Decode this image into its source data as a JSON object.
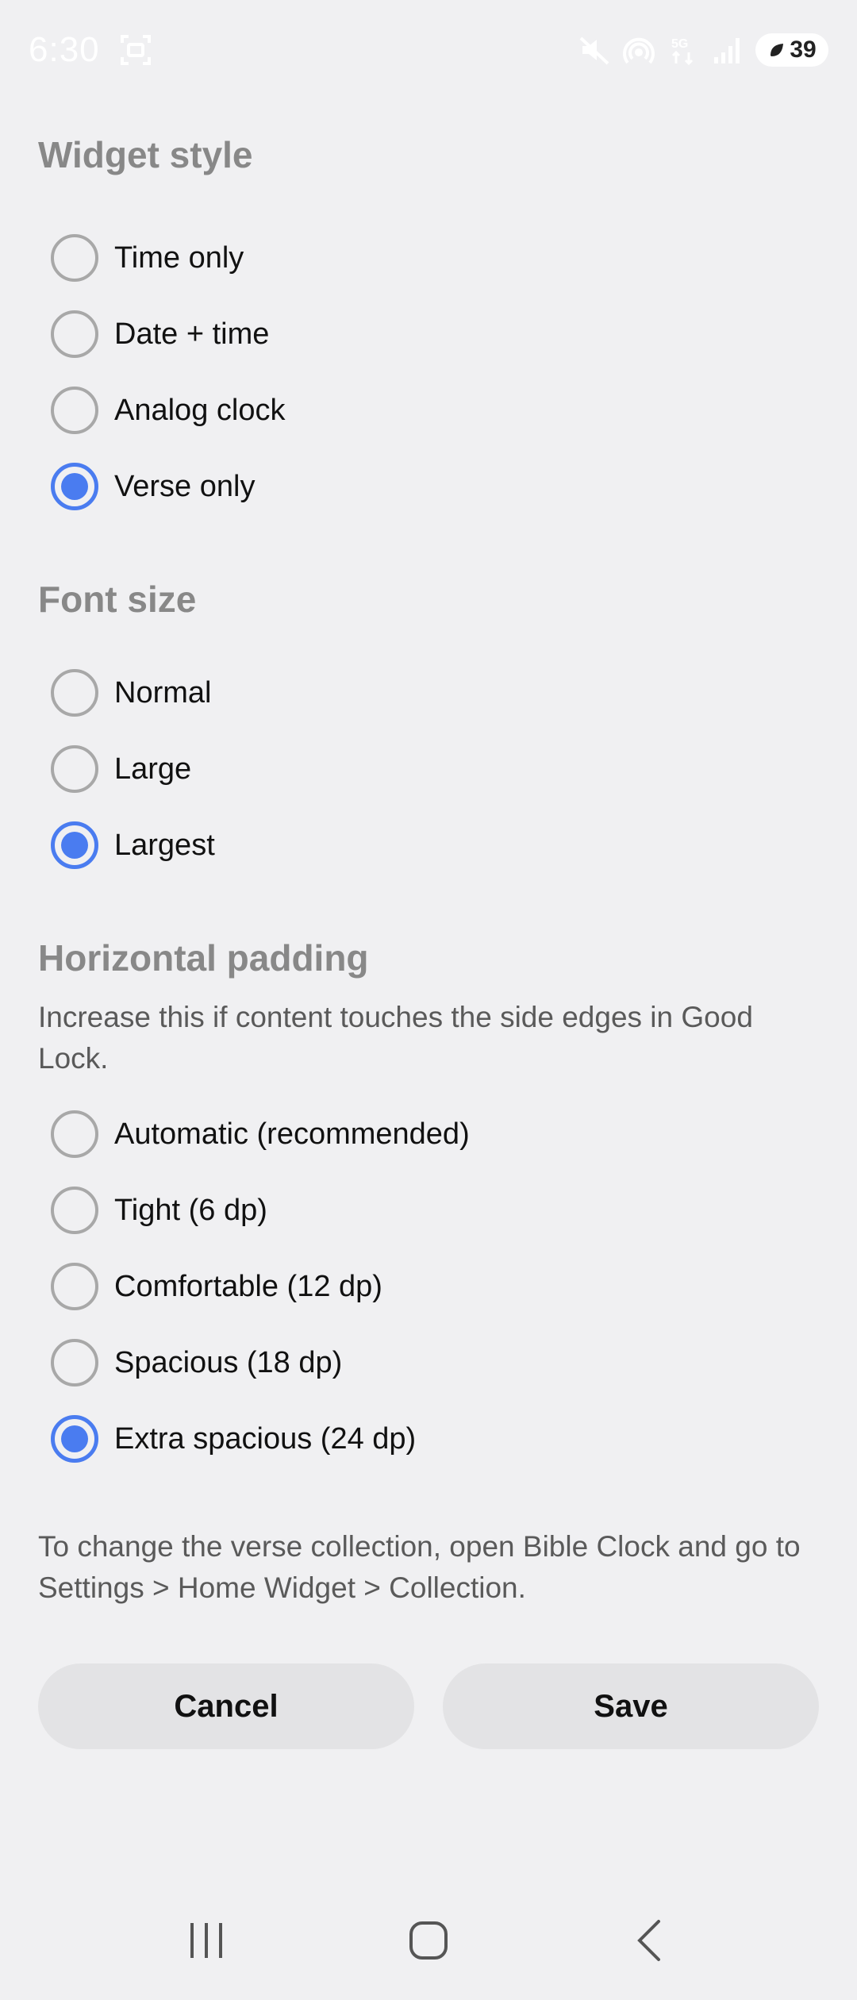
{
  "status_bar": {
    "time": "6:30",
    "battery": "39",
    "icons": [
      "screenshot-icon",
      "mute-icon",
      "hotspot-icon",
      "5g-icon",
      "signal-icon",
      "battery-saver-icon"
    ]
  },
  "widget_style": {
    "title": "Widget style",
    "options": [
      {
        "label": "Time only",
        "checked": false
      },
      {
        "label": "Date + time",
        "checked": false
      },
      {
        "label": "Analog clock",
        "checked": false
      },
      {
        "label": "Verse only",
        "checked": true
      }
    ]
  },
  "font_size": {
    "title": "Font size",
    "options": [
      {
        "label": "Normal",
        "checked": false
      },
      {
        "label": "Large",
        "checked": false
      },
      {
        "label": "Largest",
        "checked": true
      }
    ]
  },
  "horizontal_padding": {
    "title": "Horizontal padding",
    "description": "Increase this if content touches the side edges in Good Lock.",
    "options": [
      {
        "label": "Automatic (recommended)",
        "checked": false
      },
      {
        "label": "Tight (6 dp)",
        "checked": false
      },
      {
        "label": "Comfortable (12 dp)",
        "checked": false
      },
      {
        "label": "Spacious (18 dp)",
        "checked": false
      },
      {
        "label": "Extra spacious (24 dp)",
        "checked": true
      }
    ]
  },
  "footer_note": "To change the verse collection, open Bible Clock and go to Settings > Home Widget > Collection.",
  "buttons": {
    "cancel": "Cancel",
    "save": "Save"
  },
  "colors": {
    "accent": "#4a7cf0",
    "section_title": "#888888",
    "background": "#f0f0f2",
    "button_bg": "#e3e3e5"
  }
}
